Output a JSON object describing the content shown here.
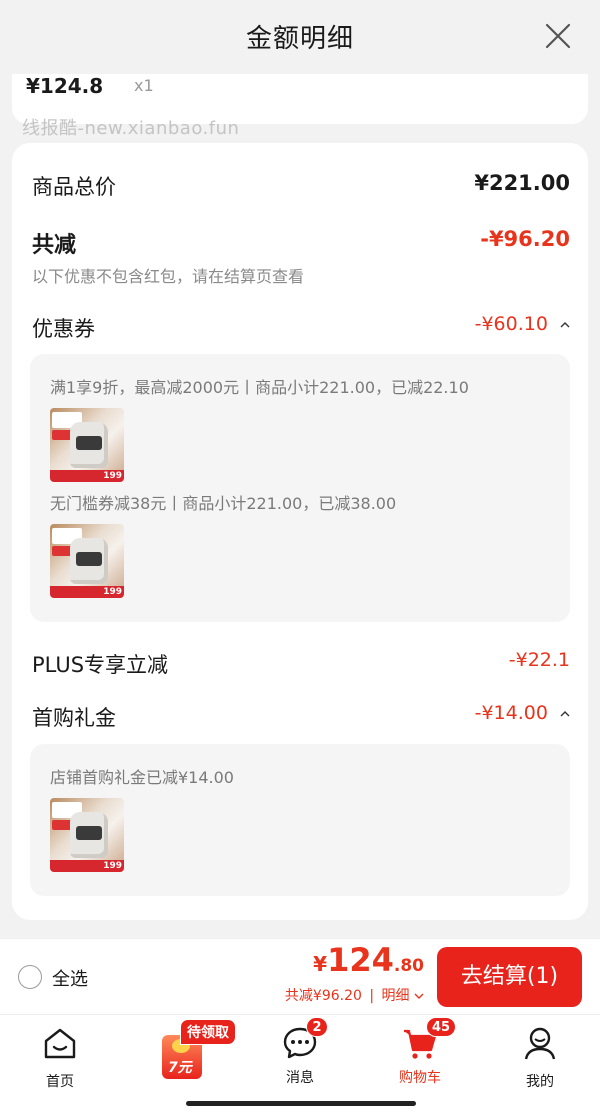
{
  "header": {
    "title": "金额明细"
  },
  "top_item": {
    "price": "¥124.8",
    "qty": "x1"
  },
  "watermark": "线报酷-new.xianbao.fun",
  "summary": {
    "goods_total_label": "商品总价",
    "goods_total_value": "¥221.00",
    "total_discount_label": "共减",
    "total_discount_value": "-¥96.20",
    "note": "以下优惠不包含红包，请在结算页查看"
  },
  "coupon": {
    "label": "优惠券",
    "value": "-¥60.10",
    "lines": [
      "满1享9折，最高减2000元丨商品小计221.00，已减22.10",
      "无门槛券减38元丨商品小计221.00，已减38.00"
    ]
  },
  "plus": {
    "label": "PLUS专享立减",
    "value": "-¥22.1"
  },
  "first_buy": {
    "label": "首购礼金",
    "value": "-¥14.00",
    "lines": [
      "店铺首购礼金已减¥14.00"
    ]
  },
  "thumb_badge": "199",
  "footer": {
    "select_all": "全选",
    "currency": "¥",
    "total_int": "124",
    "total_dec": ".80",
    "saved": "共减¥96.20",
    "sep": "|",
    "detail": "明细",
    "checkout": "去结算(1)"
  },
  "tabbar": {
    "home": "首页",
    "promo_badge": "待领取",
    "promo_amount": "7元",
    "messages": "消息",
    "messages_badge": "2",
    "cart": "购物车",
    "cart_badge": "45",
    "mine": "我的"
  },
  "colors": {
    "accent": "#e8231c",
    "price_red": "#e8341c"
  }
}
